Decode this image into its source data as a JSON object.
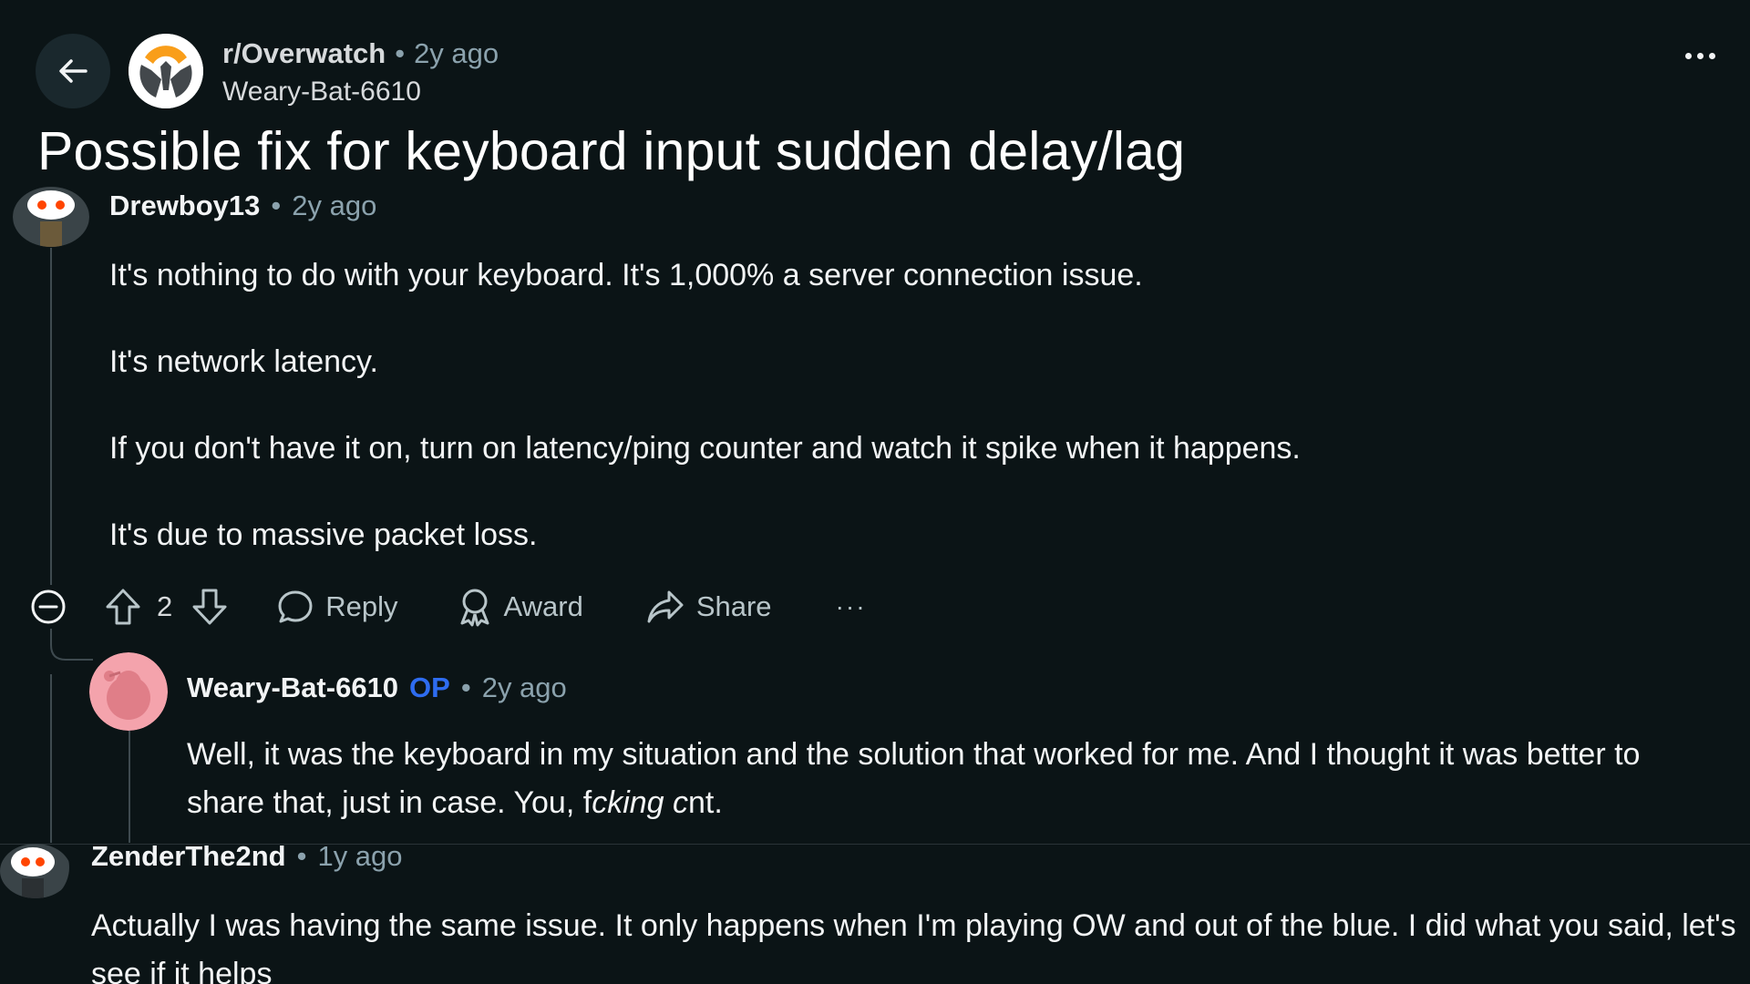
{
  "header": {
    "subreddit": "r/Overwatch",
    "separator": "•",
    "post_age": "2y ago",
    "post_author": "Weary-Bat-6610"
  },
  "post": {
    "title": "Possible fix for keyboard input sudden delay/lag"
  },
  "comments": [
    {
      "author": "Drewboy13",
      "separator": "•",
      "age": "2y ago",
      "paragraphs": [
        "It's nothing to do with your keyboard. It's 1,000% a server connection issue.",
        "It's network latency.",
        "If you don't have it on, turn on latency/ping counter and watch it spike when it happens.",
        "It's due to massive packet loss."
      ],
      "score": "2",
      "actions": {
        "reply": "Reply",
        "award": "Award",
        "share": "Share",
        "more": "···"
      }
    },
    {
      "author": "Weary-Bat-6610",
      "op_label": "OP",
      "separator": "•",
      "age": "2y ago",
      "body_part1": "Well, it was the keyboard in my situation and the solution that worked for me. And I thought it was better to share that, just in case. You, f",
      "body_italic1": "cking c",
      "body_part2": "nt."
    },
    {
      "author": "ZenderThe2nd",
      "separator": "•",
      "age": "1y ago",
      "body": "Actually I was having the same issue. It only happens when I'm playing OW and out of the blue. I did what you said, let's see if it helps"
    }
  ],
  "colors": {
    "background": "#0b1416",
    "op_blue": "#2e6cf0",
    "overwatch_orange": "#f99e1a",
    "avatar_pink": "#f4a3ac"
  },
  "icons": [
    "back-arrow-icon",
    "overwatch-logo",
    "more-dots-icon",
    "collapse-icon",
    "upvote-icon",
    "downvote-icon",
    "reply-icon",
    "award-icon",
    "share-icon"
  ]
}
